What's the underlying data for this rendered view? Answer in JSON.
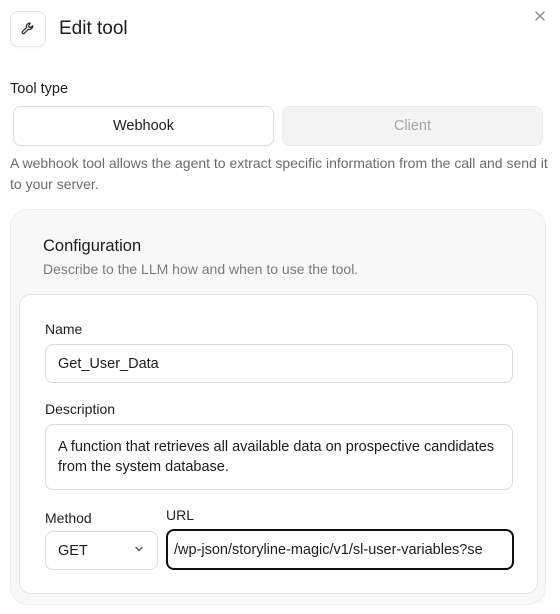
{
  "header": {
    "title": "Edit tool",
    "icon": "wrench-icon",
    "close_icon": "close-icon"
  },
  "tool_type": {
    "label": "Tool type",
    "options": [
      {
        "label": "Webhook",
        "selected": true
      },
      {
        "label": "Client",
        "selected": false
      }
    ],
    "description": "A webhook tool allows the agent to extract specific information from the call and send it to your server."
  },
  "configuration": {
    "title": "Configuration",
    "description": "Describe to the LLM how and when to use the tool.",
    "name": {
      "label": "Name",
      "value": "Get_User_Data"
    },
    "description_field": {
      "label": "Description",
      "value": "A function that retrieves all available data on prospective candidates from the system database."
    },
    "method": {
      "label": "Method",
      "value": "GET"
    },
    "url": {
      "label": "URL",
      "value": "/wp-json/storyline-magic/v1/sl-user-variables?se"
    }
  }
}
